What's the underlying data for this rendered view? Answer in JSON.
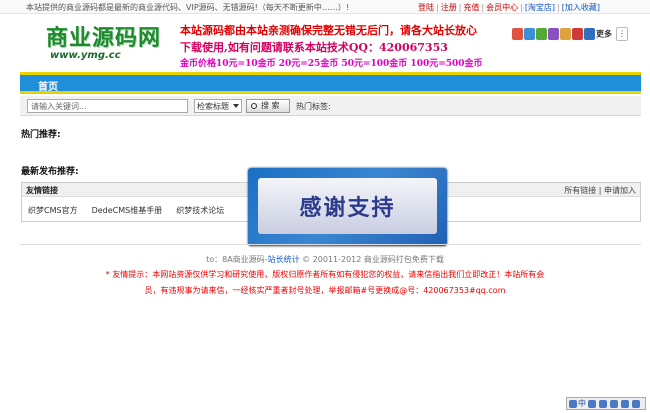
{
  "topbar": {
    "notice": "本站提供的商业源码都是最新的商业源代码、VIP源码、无错源码!（每天不断更新中……）!",
    "links": {
      "login": "登陆",
      "register": "注册",
      "recharge": "充值",
      "member_center": "会员中心",
      "taobao": "[淘宝店]",
      "favorite": "[加入收藏]"
    }
  },
  "logo": {
    "name": "商业源码网",
    "url": "www.ymg.cc"
  },
  "ad": {
    "line1": "本站源码都由本站亲测确保完整无错无后门，请各大站长放心",
    "line2": "下载使用,如有问题请联系本站技术QQ：420067353",
    "line3": "金币价格10元=10金币 20元=25金币 50元=100金币 100元=500金币"
  },
  "share": {
    "more_label": "更多",
    "colors": [
      "#e0533f",
      "#3b8fd8",
      "#55aa33",
      "#8a4fbf",
      "#e0a23a",
      "#d03a3a",
      "#2f6fbf",
      "#3aa7c4"
    ]
  },
  "nav": {
    "home": "首页"
  },
  "search": {
    "placeholder": "请输入关键词...",
    "select_value": "检索标题",
    "button": "搜 索",
    "hot_label": "热门标签:"
  },
  "sections": {
    "hot_recommend": "热门推荐:",
    "latest_recommend": "最新发布推荐:"
  },
  "friend_links": {
    "title": "友情链接",
    "all_links": "所有链接",
    "apply": "申请加入",
    "items": [
      "织梦CMS官方",
      "DedeCMS维基手册",
      "织梦技术论坛"
    ]
  },
  "overlay": {
    "text": "感谢支持"
  },
  "footer": {
    "prefix": "to：8A商业源码-",
    "stats_link": "站长统计",
    "copyright": "© 20011-2012 商业源码打包免费下载",
    "warning_line1": "* 友情提示：本网站资源仅供学习和研究使用，版权归原作者所有如有侵犯您的权益，请来信指出我们立即改正！本站所有会",
    "warning_line2": "员，有违规事为请来信，一经核实严重者封号处理，举报邮箱#号更换成@号：420067353#qq.com"
  },
  "tray": {
    "label": "中"
  }
}
